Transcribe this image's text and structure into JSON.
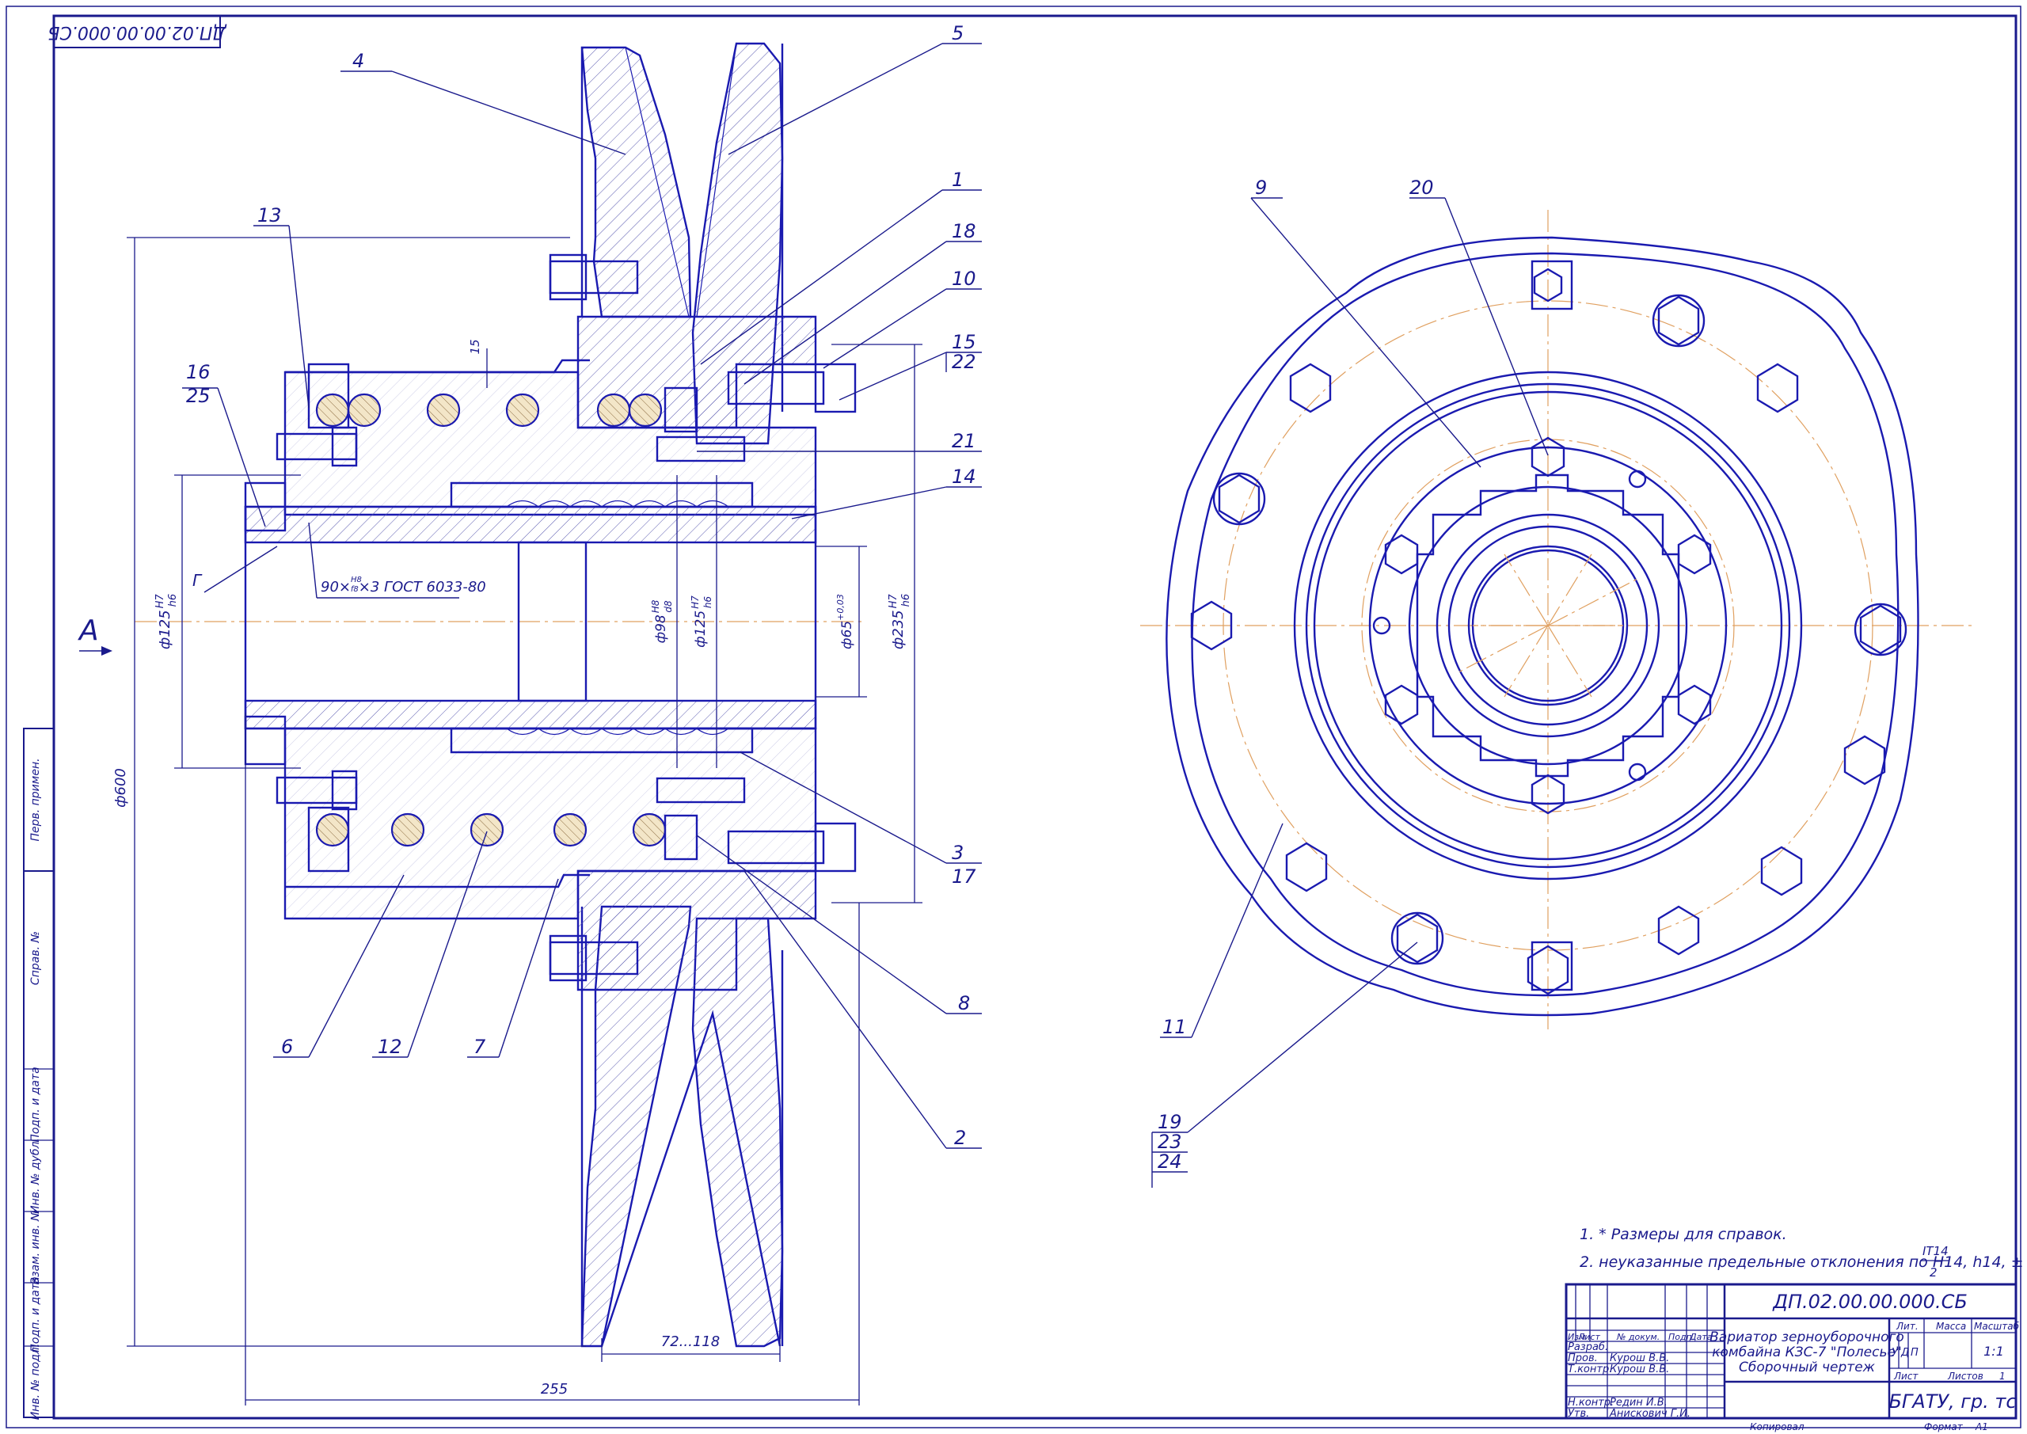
{
  "drawing": {
    "corner_code": "ДП.02.00.00.000.СБ",
    "view_label": "А",
    "section_label": "Г",
    "spline_spec": "90×",
    "spline_fit_top": "H8",
    "spline_fit_bottom": "f8",
    "spline_tail": "×3 ГОСТ 6033-80"
  },
  "positions": [
    "1",
    "2",
    "3",
    "4",
    "5",
    "6",
    "7",
    "8",
    "9",
    "10",
    "11",
    "12",
    "13",
    "14",
    "15",
    "16",
    "17",
    "18",
    "19",
    "20",
    "21",
    "22",
    "23",
    "24",
    "25"
  ],
  "dimensions": {
    "d600": "ф600",
    "d125_left": "ф125",
    "d125_left_fit_top": "H7",
    "d125_left_fit_bottom": "h6",
    "d98": "ф98",
    "d98_fit_top": "H8",
    "d98_fit_bottom": "d8",
    "d125_mid": "ф125",
    "d125_mid_fit_top": "H7",
    "d125_mid_fit_bottom": "h6",
    "d65": "ф65",
    "d65_tol": "+0,03",
    "d235": "ф235",
    "d235_fit_top": "H7",
    "d235_fit_bottom": "h6",
    "gap": "15",
    "stroke_range": "72...118",
    "overall": "255"
  },
  "notes": [
    "1. * Размеры для справок.",
    "2. неуказанные предельные отклонения по H14, h14, ±"
  ],
  "note_fraction_top": "IT14",
  "note_fraction_bottom": "2",
  "side_stamp": [
    "Перв. примен.",
    "Справ. №",
    "Подп. и дата",
    "Инв. № дубл.",
    "Взам. инв. №",
    "Подп. и дата",
    "Инв. № подл."
  ],
  "title_block": {
    "designation": "ДП.02.00.00.000.СБ",
    "title_line1": "Вариатор зерноуборочного",
    "title_line2": "комбайна КЗС-7 \"Полесье\"",
    "title_line3": "Сборочный чертеж",
    "col_headers": [
      "Изм",
      "Лист",
      "№ докум.",
      "Подп.",
      "Дата"
    ],
    "rows": [
      {
        "role": "Разраб.",
        "name": ""
      },
      {
        "role": "Пров.",
        "name": "Курош В.В."
      },
      {
        "role": "Т.контр.",
        "name": "Курош В.В."
      },
      {
        "role": "",
        "name": ""
      },
      {
        "role": "Н.контр.",
        "name": "Редин И.В."
      },
      {
        "role": "Утв.",
        "name": "Анискович Г.И."
      }
    ],
    "lit_label": "Лит.",
    "mass_label": "Масса",
    "scale_label": "Масштаб",
    "lit_values": [
      "У",
      "Д",
      "П"
    ],
    "scale_value": "1:1",
    "sheet_label": "Лист",
    "sheets_label": "Листов",
    "sheets_value": "1",
    "org": "БГАТУ, гр. тс",
    "copied": "Копировал",
    "format_label": "Формат",
    "format_value": "А1"
  }
}
